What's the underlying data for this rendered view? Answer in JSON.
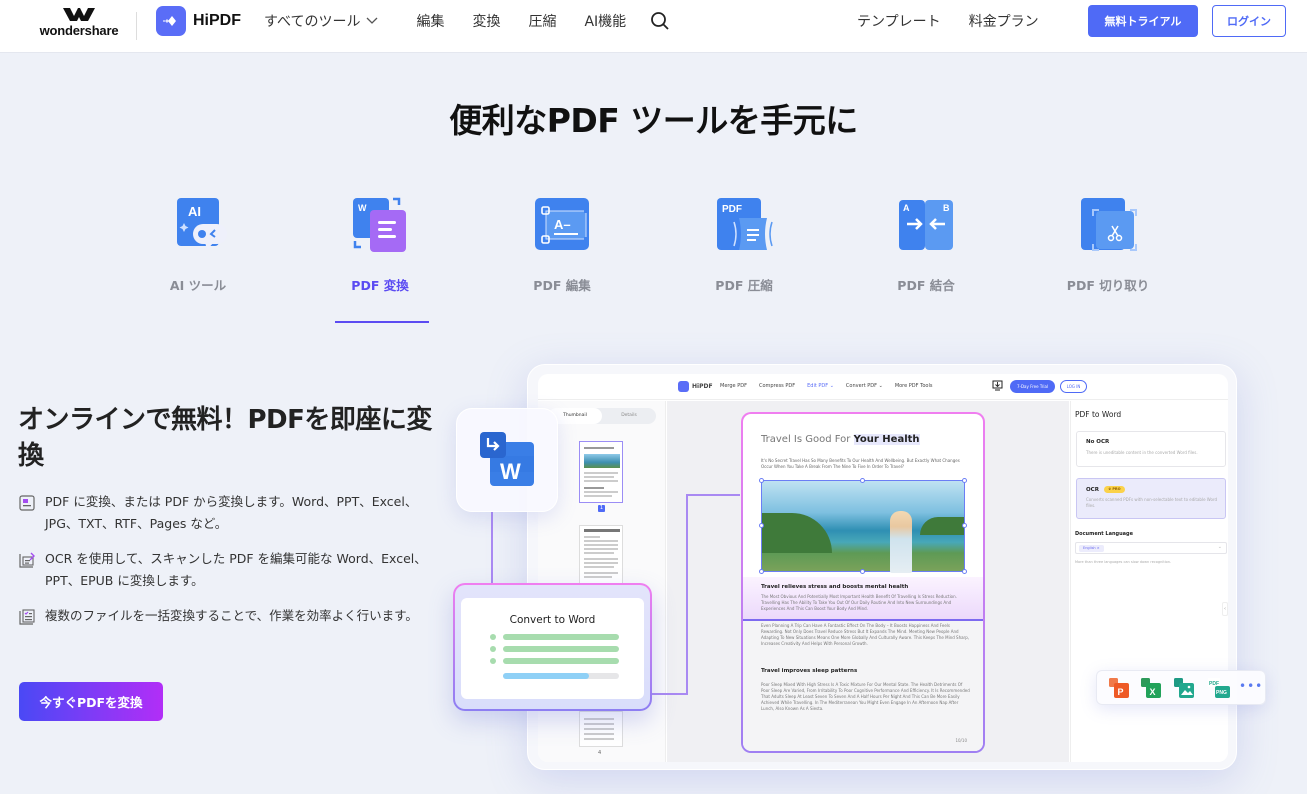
{
  "header": {
    "brand": "wondershare",
    "product": "HiPDF",
    "nav": [
      {
        "label": "すべてのツール",
        "has_dropdown": true
      },
      {
        "label": "編集"
      },
      {
        "label": "変換"
      },
      {
        "label": "圧縮"
      },
      {
        "label": "AI機能"
      }
    ],
    "nav_right": [
      "テンプレート",
      "料金プラン"
    ],
    "trial_button": "無料トライアル",
    "login_button": "ログイン",
    "accent_color": "#4f6af6"
  },
  "hero": {
    "title": "便利なPDF ツールを手元に",
    "tools": [
      {
        "label": "AI ツール",
        "icon": "ai-chat-icon",
        "active": false
      },
      {
        "label": "PDF 変換",
        "icon": "convert-icon",
        "active": true
      },
      {
        "label": "PDF 編集",
        "icon": "edit-icon",
        "active": false
      },
      {
        "label": "PDF 圧縮",
        "icon": "compress-icon",
        "active": false
      },
      {
        "label": "PDF 結合",
        "icon": "merge-icon",
        "active": false
      },
      {
        "label": "PDF 切り取り",
        "icon": "crop-icon",
        "active": false
      }
    ],
    "active_color": "#5b4bf2"
  },
  "feature": {
    "heading": "オンラインで無料！PDFを即座に変換",
    "bullets": [
      {
        "icon": "document-icon",
        "text": "PDF に変換、または PDF から変換します。Word、PPT、Excel、JPG、TXT、RTF、Pages など。"
      },
      {
        "icon": "ocr-edit-icon",
        "text": "OCR を使用して、スキャンした PDF を編集可能な Word、Excel、PPT、EPUB に変換します。"
      },
      {
        "icon": "batch-list-icon",
        "text": "複数のファイルを一括変換することで、作業を効率よく行います。"
      }
    ],
    "cta": "今すぐPDFを変換"
  },
  "mockup": {
    "app_logo": "HiPDF",
    "nav": [
      "Merge PDF",
      "Compress PDF",
      "Edit PDF ⌄",
      "Convert PDF ⌄",
      "More PDF Tools"
    ],
    "trial": "7-Day Free Trial",
    "login": "LOG IN",
    "tabs": [
      "Thumbnail",
      "Details"
    ],
    "thumb_selected_page": "1",
    "thumb_last_page": "4",
    "document": {
      "title_plain": "Travel Is Good For ",
      "title_highlight": "Your Health",
      "intro": "It's No Secret Travel Has So Many Benefits To Our Health And Wellbeing. But Exactly What Changes Occur When You Take A Break From The Nine To Five In Order To Travel?",
      "section1_heading": "Travel relieves stress and boosts mental health",
      "section1_text": "The Most Obvious And Potentially Most Important Health Benefit Of Travelling Is Stress Reduction. Travelling Has The Ability To Take You Out Of Our Daily Routine And Into New Surroundings And Experiences And This Can Boost Your Body And Mind.",
      "section1_more": "Even Planning A Trip Can Have A Fantastic Effect On The Body – It Boosts Happiness And Feels Rewarding. Not Only Does Travel Reduce Stress But It Expands The Mind. Meeting New People And Adapting To New Situations Means One More Globally And Culturally Aware. This Keeps The Mind Sharp, Increases Creativity And Helps With Personal Growth.",
      "section2_heading": "Travel improves sleep patterns",
      "section2_text": "Poor Sleep Mixed With High Stress Is A Toxic Mixture For Our Mental State. The Health Detriments Of Poor Sleep Are Varied, From Irritability To Poor Cognitive Performance And Efficiency. It Is Recommended That Adults Sleep At Least Seven To Seven And A Half Hours Per Night And This Can Be More Easily Achieved While Travelling. In The Mediterranean You Might Even Engage In An Afternoon Nap After Lunch, Also Known As A Siesta.",
      "page_num": "10/10"
    },
    "panel": {
      "title": "PDF to Word",
      "options": [
        {
          "title": "No OCR",
          "desc": "There is uneditable content in the converted Word files.",
          "pro": false
        },
        {
          "title": "OCR",
          "desc": "Converts scanned PDFs with non-selectable text to editable Word files.",
          "pro": true,
          "badge": "PRO"
        }
      ],
      "language_label": "Document Language",
      "language_value": "English ×",
      "note": "More than three languages can slow down recognition."
    },
    "convert_card": {
      "title": "Convert to Word",
      "progress": 0.74
    },
    "formats": [
      "PPT",
      "XLS",
      "IMG",
      "PNG"
    ],
    "formats_more": "•••"
  }
}
